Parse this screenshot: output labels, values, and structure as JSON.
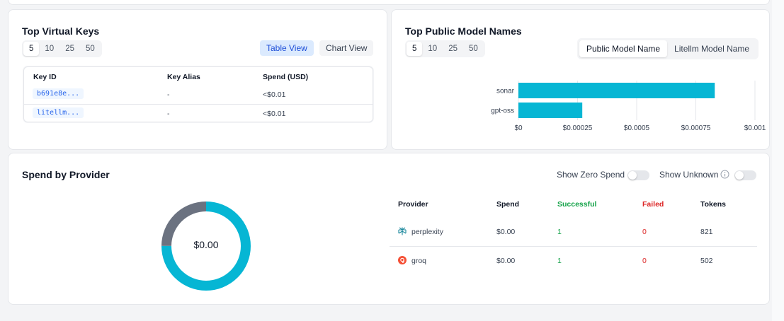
{
  "top_keys": {
    "title": "Top Virtual Keys",
    "limits": [
      "5",
      "10",
      "25",
      "50"
    ],
    "active_limit": "5",
    "table_view_label": "Table View",
    "chart_view_label": "Chart View",
    "columns": [
      "Key ID",
      "Key Alias",
      "Spend (USD)"
    ],
    "rows": [
      {
        "key_id": "b691e8e...",
        "alias": "-",
        "spend": "<$0.01"
      },
      {
        "key_id": "litellm...",
        "alias": "-",
        "spend": "<$0.01"
      }
    ]
  },
  "top_models": {
    "title": "Top Public Model Names",
    "limits": [
      "5",
      "10",
      "25",
      "50"
    ],
    "active_limit": "5",
    "tabs": [
      "Public Model Name",
      "Litellm Model Name"
    ],
    "active_tab": "Public Model Name",
    "chart_data": {
      "type": "bar",
      "orientation": "horizontal",
      "categories": [
        "sonar",
        "gpt-oss"
      ],
      "values": [
        0.00083,
        0.00027
      ],
      "xlim": [
        0,
        0.001
      ],
      "x_ticks": [
        "$0",
        "$0.00025",
        "$0.0005",
        "$0.00075",
        "$0.001"
      ],
      "grid": true,
      "bar_color": "#06b6d4"
    }
  },
  "provider": {
    "title": "Spend by Provider",
    "show_zero_spend_label": "Show Zero Spend",
    "show_unknown_label": "Show Unknown",
    "donut_center": "$0.00",
    "donut": {
      "segments": [
        {
          "provider": "perplexity",
          "fraction": 0.75,
          "color": "#06b6d4"
        },
        {
          "provider": "groq",
          "fraction": 0.25,
          "color": "#6b7280"
        }
      ]
    },
    "columns": {
      "provider": "Provider",
      "spend": "Spend",
      "successful": "Successful",
      "failed": "Failed",
      "tokens": "Tokens"
    },
    "rows": [
      {
        "provider": "perplexity",
        "spend": "$0.00",
        "successful": "1",
        "failed": "0",
        "tokens": "821"
      },
      {
        "provider": "groq",
        "spend": "$0.00",
        "successful": "1",
        "failed": "0",
        "tokens": "502"
      }
    ]
  }
}
